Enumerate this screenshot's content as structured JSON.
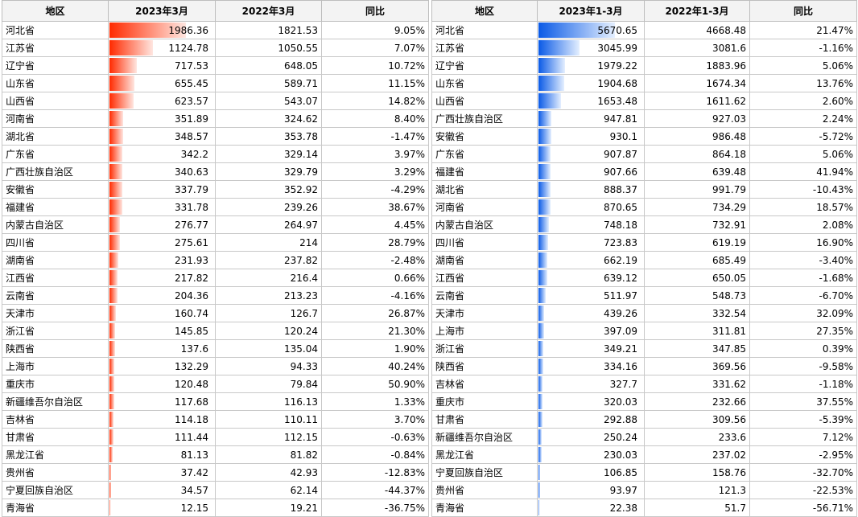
{
  "left_table": {
    "headers": [
      "地区",
      "2023年3月",
      "2022年3月",
      "同比"
    ],
    "bar_max": 1986.36,
    "rows": [
      [
        "河北省",
        1986.36,
        "1821.53",
        "9.05%"
      ],
      [
        "江苏省",
        1124.78,
        "1050.55",
        "7.07%"
      ],
      [
        "辽宁省",
        717.53,
        "648.05",
        "10.72%"
      ],
      [
        "山东省",
        655.45,
        "589.71",
        "11.15%"
      ],
      [
        "山西省",
        623.57,
        "543.07",
        "14.82%"
      ],
      [
        "河南省",
        351.89,
        "324.62",
        "8.40%"
      ],
      [
        "湖北省",
        348.57,
        "353.78",
        "-1.47%"
      ],
      [
        "广东省",
        342.2,
        "329.14",
        "3.97%"
      ],
      [
        "广西壮族自治区",
        340.63,
        "329.79",
        "3.29%"
      ],
      [
        "安徽省",
        337.79,
        "352.92",
        "-4.29%"
      ],
      [
        "福建省",
        331.78,
        "239.26",
        "38.67%"
      ],
      [
        "内蒙古自治区",
        276.77,
        "264.97",
        "4.45%"
      ],
      [
        "四川省",
        275.61,
        "214",
        "28.79%"
      ],
      [
        "湖南省",
        231.93,
        "237.82",
        "-2.48%"
      ],
      [
        "江西省",
        217.82,
        "216.4",
        "0.66%"
      ],
      [
        "云南省",
        204.36,
        "213.23",
        "-4.16%"
      ],
      [
        "天津市",
        160.74,
        "126.7",
        "26.87%"
      ],
      [
        "浙江省",
        145.85,
        "120.24",
        "21.30%"
      ],
      [
        "陕西省",
        137.6,
        "135.04",
        "1.90%"
      ],
      [
        "上海市",
        132.29,
        "94.33",
        "40.24%"
      ],
      [
        "重庆市",
        120.48,
        "79.84",
        "50.90%"
      ],
      [
        "新疆维吾尔自治区",
        117.68,
        "116.13",
        "1.33%"
      ],
      [
        "吉林省",
        114.18,
        "110.11",
        "3.70%"
      ],
      [
        "甘肃省",
        111.44,
        "112.15",
        "-0.63%"
      ],
      [
        "黑龙江省",
        81.13,
        "81.82",
        "-0.84%"
      ],
      [
        "贵州省",
        37.42,
        "42.93",
        "-12.83%"
      ],
      [
        "宁夏回族自治区",
        34.57,
        "62.14",
        "-44.37%"
      ],
      [
        "青海省",
        12.15,
        "19.21",
        "-36.75%"
      ]
    ]
  },
  "right_table": {
    "headers": [
      "地区",
      "2023年1-3月",
      "2022年1-3月",
      "同比"
    ],
    "bar_max": 5670.65,
    "rows": [
      [
        "河北省",
        5670.65,
        "4668.48",
        "21.47%"
      ],
      [
        "江苏省",
        3045.99,
        "3081.6",
        "-1.16%"
      ],
      [
        "辽宁省",
        1979.22,
        "1883.96",
        "5.06%"
      ],
      [
        "山东省",
        1904.68,
        "1674.34",
        "13.76%"
      ],
      [
        "山西省",
        1653.48,
        "1611.62",
        "2.60%"
      ],
      [
        "广西壮族自治区",
        947.81,
        "927.03",
        "2.24%"
      ],
      [
        "安徽省",
        930.1,
        "986.48",
        "-5.72%"
      ],
      [
        "广东省",
        907.87,
        "864.18",
        "5.06%"
      ],
      [
        "福建省",
        907.66,
        "639.48",
        "41.94%"
      ],
      [
        "湖北省",
        888.37,
        "991.79",
        "-10.43%"
      ],
      [
        "河南省",
        870.65,
        "734.29",
        "18.57%"
      ],
      [
        "内蒙古自治区",
        748.18,
        "732.91",
        "2.08%"
      ],
      [
        "四川省",
        723.83,
        "619.19",
        "16.90%"
      ],
      [
        "湖南省",
        662.19,
        "685.49",
        "-3.40%"
      ],
      [
        "江西省",
        639.12,
        "650.05",
        "-1.68%"
      ],
      [
        "云南省",
        511.97,
        "548.73",
        "-6.70%"
      ],
      [
        "天津市",
        439.26,
        "332.54",
        "32.09%"
      ],
      [
        "上海市",
        397.09,
        "311.81",
        "27.35%"
      ],
      [
        "浙江省",
        349.21,
        "347.85",
        "0.39%"
      ],
      [
        "陕西省",
        334.16,
        "369.56",
        "-9.58%"
      ],
      [
        "吉林省",
        327.7,
        "331.62",
        "-1.18%"
      ],
      [
        "重庆市",
        320.03,
        "232.66",
        "37.55%"
      ],
      [
        "甘肃省",
        292.88,
        "309.56",
        "-5.39%"
      ],
      [
        "新疆维吾尔自治区",
        250.24,
        "233.6",
        "7.12%"
      ],
      [
        "黑龙江省",
        230.03,
        "237.02",
        "-2.95%"
      ],
      [
        "宁夏回族自治区",
        106.85,
        "158.76",
        "-32.70%"
      ],
      [
        "贵州省",
        93.97,
        "121.3",
        "-22.53%"
      ],
      [
        "青海省",
        22.38,
        "51.7",
        "-56.71%"
      ]
    ]
  }
}
